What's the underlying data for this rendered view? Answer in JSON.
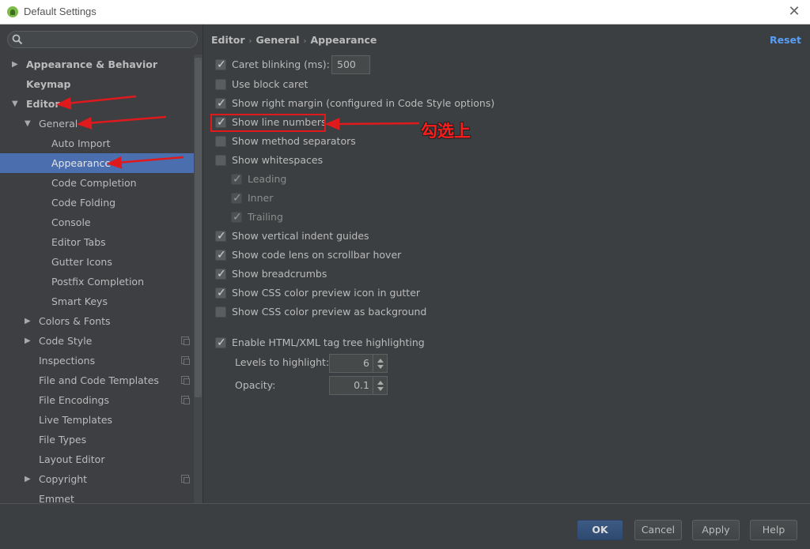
{
  "window": {
    "title": "Default Settings",
    "close_icon": "close-icon"
  },
  "sidebar": {
    "search": {
      "value": "",
      "placeholder": ""
    },
    "items": [
      {
        "label": "Appearance & Behavior",
        "level": 0,
        "arrow": "collapsed",
        "bold": true
      },
      {
        "label": "Keymap",
        "level": 0,
        "arrow": "none",
        "bold": true
      },
      {
        "label": "Editor",
        "level": 0,
        "arrow": "expanded",
        "bold": true
      },
      {
        "label": "General",
        "level": 1,
        "arrow": "expanded"
      },
      {
        "label": "Auto Import",
        "level": 2,
        "arrow": "none"
      },
      {
        "label": "Appearance",
        "level": 2,
        "arrow": "none",
        "selected": true
      },
      {
        "label": "Code Completion",
        "level": 2,
        "arrow": "none"
      },
      {
        "label": "Code Folding",
        "level": 2,
        "arrow": "none"
      },
      {
        "label": "Console",
        "level": 2,
        "arrow": "none"
      },
      {
        "label": "Editor Tabs",
        "level": 2,
        "arrow": "none"
      },
      {
        "label": "Gutter Icons",
        "level": 2,
        "arrow": "none"
      },
      {
        "label": "Postfix Completion",
        "level": 2,
        "arrow": "none"
      },
      {
        "label": "Smart Keys",
        "level": 2,
        "arrow": "none"
      },
      {
        "label": "Colors & Fonts",
        "level": 1,
        "arrow": "collapsed"
      },
      {
        "label": "Code Style",
        "level": 1,
        "arrow": "collapsed",
        "project_icon": true
      },
      {
        "label": "Inspections",
        "level": 1,
        "arrow": "none",
        "project_icon": true
      },
      {
        "label": "File and Code Templates",
        "level": 1,
        "arrow": "none",
        "project_icon": true
      },
      {
        "label": "File Encodings",
        "level": 1,
        "arrow": "none",
        "project_icon": true
      },
      {
        "label": "Live Templates",
        "level": 1,
        "arrow": "none"
      },
      {
        "label": "File Types",
        "level": 1,
        "arrow": "none"
      },
      {
        "label": "Layout Editor",
        "level": 1,
        "arrow": "none"
      },
      {
        "label": "Copyright",
        "level": 1,
        "arrow": "collapsed",
        "project_icon": true
      },
      {
        "label": "Emmet",
        "level": 1,
        "arrow": "none"
      }
    ]
  },
  "content": {
    "breadcrumb": [
      "Editor",
      "General",
      "Appearance"
    ],
    "breadcrumb_sep": "›",
    "reset_label": "Reset",
    "options": [
      {
        "label": "Caret blinking (ms):",
        "checked": true
      },
      {
        "label": "Use block caret",
        "checked": false
      },
      {
        "label": "Show right margin (configured in Code Style options)",
        "checked": true
      },
      {
        "label": "Show line numbers",
        "checked": true
      },
      {
        "label": "Show method separators",
        "checked": false
      },
      {
        "label": "Show whitespaces",
        "checked": false
      },
      {
        "label": "Leading",
        "checked": true,
        "disabled": true
      },
      {
        "label": "Inner",
        "checked": true,
        "disabled": true
      },
      {
        "label": "Trailing",
        "checked": true,
        "disabled": true
      },
      {
        "label": "Show vertical indent guides",
        "checked": true
      },
      {
        "label": "Show code lens on scrollbar hover",
        "checked": true
      },
      {
        "label": "Show breadcrumbs",
        "checked": true
      },
      {
        "label": "Show CSS color preview icon in gutter",
        "checked": true
      },
      {
        "label": "Show CSS color preview as background",
        "checked": false
      },
      {
        "label": "Enable HTML/XML tag tree highlighting",
        "checked": true
      }
    ],
    "caret_blinking_value": "500",
    "levels_label": "Levels to highlight:",
    "levels_value": "6",
    "opacity_label": "Opacity:",
    "opacity_value": "0.1"
  },
  "footer": {
    "ok": "OK",
    "cancel": "Cancel",
    "apply": "Apply",
    "help": "Help"
  },
  "annotation": {
    "text": "勾选上",
    "color": "#e0191c"
  },
  "colors": {
    "accent": "#589df6",
    "selection": "#4b6eaf",
    "background": "#3c3f41"
  }
}
